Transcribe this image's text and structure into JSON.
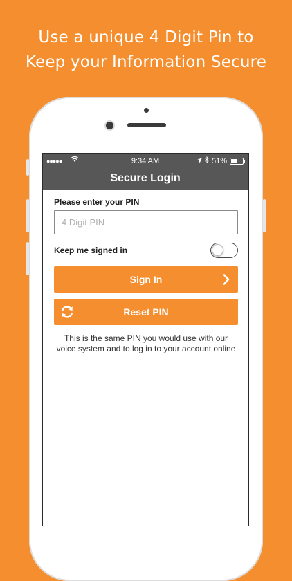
{
  "headline": {
    "line1": "Use a unique 4 Digit Pin to",
    "line2": "Keep your Information Secure"
  },
  "status_bar": {
    "signal": "●●●●●",
    "time": "9:34 AM",
    "battery": "51%",
    "battery_level": 0.51
  },
  "nav": {
    "title": "Secure Login"
  },
  "form": {
    "pin_label": "Please enter your PIN",
    "pin_placeholder": "4 Digit PIN",
    "pin_value": "",
    "keep_signed_in_label": "Keep me signed in",
    "keep_signed_in": false,
    "sign_in_label": "Sign In",
    "reset_pin_label": "Reset PIN"
  },
  "info_text": "This is the same PIN you would use with our voice system and to log in to your account online",
  "colors": {
    "brand_orange": "#F58E2E",
    "bar_gray": "#575757"
  },
  "icons": {
    "sign_in": "chevron-right-icon",
    "reset": "refresh-icon"
  }
}
